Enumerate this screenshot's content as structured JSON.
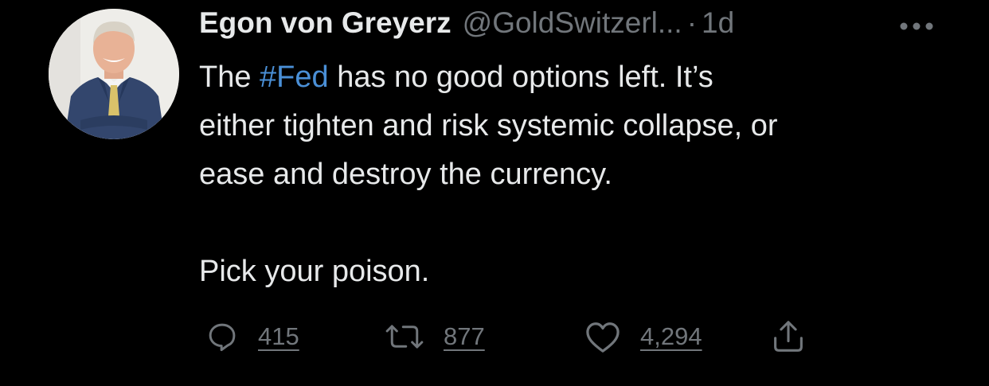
{
  "tweet": {
    "author_name": "Egon von Greyerz",
    "handle": "@GoldSwitzerl...",
    "separator": "·",
    "time": "1d",
    "more_icon": "more-icon",
    "text_line1_pre": "The ",
    "hashtag": "#Fed",
    "text_line1_post": " has no good options left. It’s",
    "text_line2": "either tighten and risk systemic collapse, or",
    "text_line3": "ease and destroy the currency.",
    "text_line4": "Pick your poison.",
    "colors": {
      "background": "#000000",
      "text": "#e7e9ea",
      "muted": "#71767b",
      "link": "#4a8fd6"
    }
  },
  "actions": {
    "reply_icon": "reply-icon",
    "reply_count": "415",
    "retweet_icon": "retweet-icon",
    "retweet_count": "877",
    "like_icon": "heart-icon",
    "like_count": "4,294",
    "share_icon": "share-icon"
  }
}
